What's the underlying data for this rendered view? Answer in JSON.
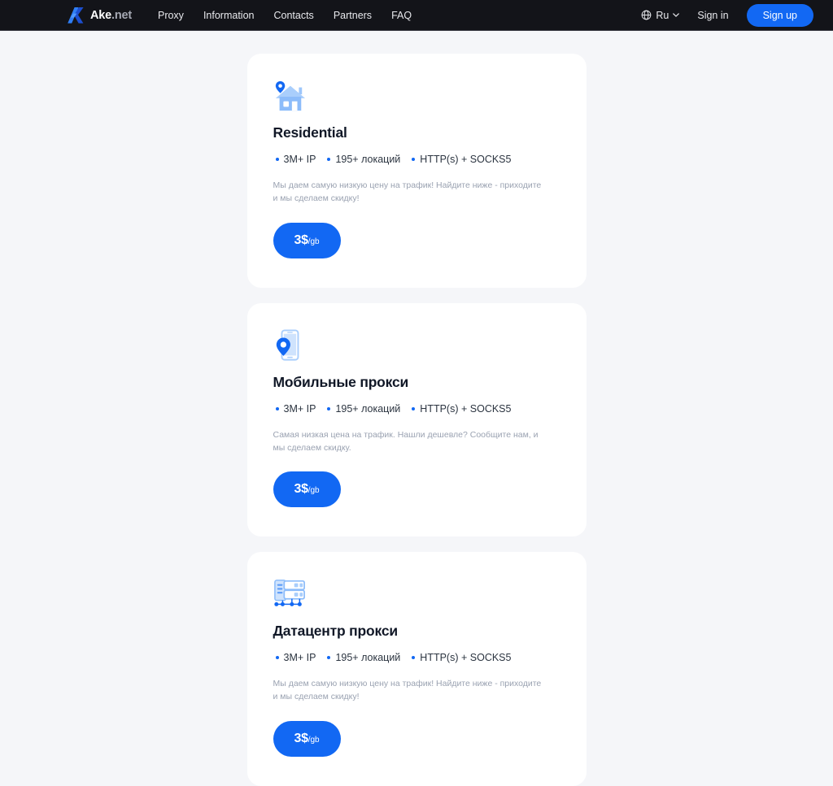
{
  "header": {
    "brand": {
      "name": "Ake",
      "tld": ".net",
      "icon": "ake-logo-icon"
    },
    "nav": [
      {
        "label": "Proxy"
      },
      {
        "label": "Information"
      },
      {
        "label": "Contacts"
      },
      {
        "label": "Partners"
      },
      {
        "label": "FAQ"
      }
    ],
    "language": {
      "label": "Ru",
      "icon": "globe-icon",
      "caret": "chevron-down-icon"
    },
    "sign_in_label": "Sign in",
    "sign_up_label": "Sign up",
    "colors": {
      "background": "#131419",
      "accent": "#1268f3",
      "text": "#e8e9ed"
    }
  },
  "page": {
    "background": "#f5f6f9",
    "card_background": "#ffffff",
    "accent": "#1268f3"
  },
  "cards": [
    {
      "icon": "house-location-pin-icon",
      "title": "Residential",
      "features": [
        "3M+ IP",
        "195+ локаций",
        "HTTP(s) + SOCKS5"
      ],
      "description": "Мы даем самую низкую цену на трафик! Найдите ниже - приходите и мы сделаем скидку!",
      "price_amount": "3$",
      "price_unit": "/gb"
    },
    {
      "icon": "mobile-phone-location-pin-icon",
      "title": "Мобильные прокси",
      "features": [
        "3M+ IP",
        "195+ локаций",
        "HTTP(s) + SOCKS5"
      ],
      "description": "Самая низкая цена на трафик. Нашли дешевле? Сообщите нам, и мы сделаем скидку.",
      "price_amount": "3$",
      "price_unit": "/gb"
    },
    {
      "icon": "datacenter-server-rack-icon",
      "title": "Датацентр прокси",
      "features": [
        "3M+ IP",
        "195+ локаций",
        "HTTP(s) + SOCKS5"
      ],
      "description": "Мы даем самую низкую цену на трафик! Найдите ниже - приходите и мы сделаем скидку!",
      "price_amount": "3$",
      "price_unit": "/gb"
    }
  ]
}
